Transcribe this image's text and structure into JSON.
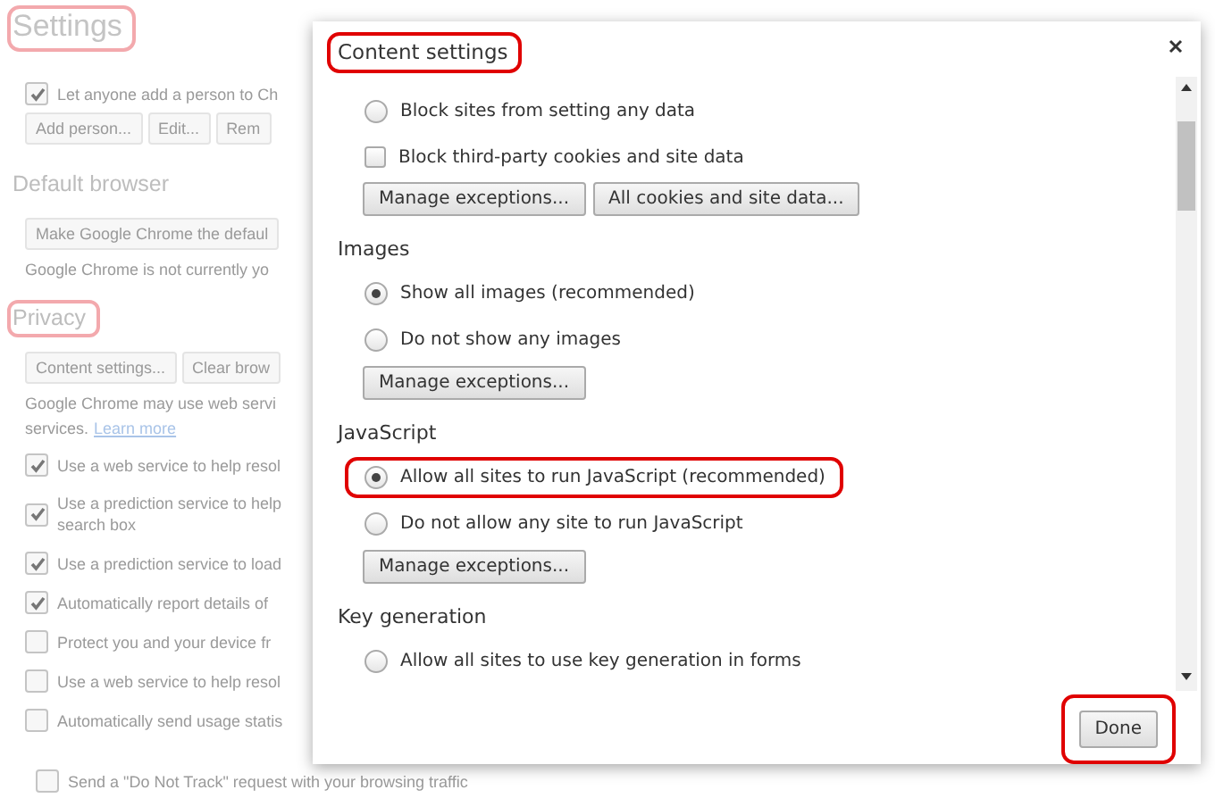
{
  "background": {
    "rows": [
      {
        "kind": "title",
        "text": "Settings",
        "highlighted": true
      },
      {
        "kind": "checkbox",
        "label": "Let anyone add a person to Ch",
        "checked": true
      },
      {
        "kind": "buttons",
        "buttons": [
          "Add person...",
          "Edit...",
          "Rem"
        ]
      },
      {
        "kind": "heading",
        "text": "Default browser",
        "highlighted": false
      },
      {
        "kind": "buttons",
        "buttons": [
          "Make Google Chrome the defaul"
        ]
      },
      {
        "kind": "text",
        "text": "Google Chrome is not currently yo"
      },
      {
        "kind": "heading",
        "text": "Privacy",
        "highlighted": true
      },
      {
        "kind": "buttons",
        "buttons": [
          "Content settings...",
          "Clear brow"
        ]
      },
      {
        "kind": "text",
        "text": "Google Chrome may use web servi"
      },
      {
        "kind": "link-text",
        "text": "services.",
        "link": "Learn more"
      },
      {
        "kind": "checkbox",
        "label": "Use a web service to help resol",
        "checked": true
      },
      {
        "kind": "checkbox",
        "label": "Use a prediction service to help",
        "label_continued": "search box",
        "checked": true
      },
      {
        "kind": "checkbox",
        "label": "Use a prediction service to load",
        "checked": true
      },
      {
        "kind": "checkbox",
        "label": "Automatically report details of",
        "checked": true
      },
      {
        "kind": "checkbox",
        "label": "Protect you and your device fr",
        "checked": false
      },
      {
        "kind": "checkbox",
        "label": "Use a web service to help resol",
        "checked": false
      },
      {
        "kind": "checkbox",
        "label": "Automatically send usage statis",
        "checked": false
      }
    ],
    "last_row": {
      "label": "Send a \"Do Not Track\" request with your browsing traffic",
      "checked": false
    }
  },
  "dialog": {
    "title": {
      "text": "Content settings",
      "highlighted": true
    },
    "sections": [
      {
        "rows": [
          {
            "kind": "radio",
            "label": "Block sites from setting any data",
            "selected": false,
            "highlighted": false
          },
          {
            "kind": "checkbox",
            "label": "Block third-party cookies and site data",
            "checked": false
          },
          {
            "kind": "buttons",
            "buttons": [
              "Manage exceptions...",
              "All cookies and site data..."
            ]
          }
        ]
      },
      {
        "heading": "Images",
        "rows": [
          {
            "kind": "radio",
            "label": "Show all images (recommended)",
            "selected": true,
            "highlighted": false
          },
          {
            "kind": "radio",
            "label": "Do not show any images",
            "selected": false,
            "highlighted": false
          },
          {
            "kind": "buttons",
            "buttons": [
              "Manage exceptions..."
            ]
          }
        ]
      },
      {
        "heading": "JavaScript",
        "rows": [
          {
            "kind": "radio",
            "label": "Allow all sites to run JavaScript (recommended)",
            "selected": true,
            "highlighted": true
          },
          {
            "kind": "radio",
            "label": "Do not allow any site to run JavaScript",
            "selected": false,
            "highlighted": false
          },
          {
            "kind": "buttons",
            "buttons": [
              "Manage exceptions..."
            ]
          }
        ]
      },
      {
        "heading": "Key generation",
        "rows": [
          {
            "kind": "radio",
            "label": "Allow all sites to use key generation in forms",
            "selected": false,
            "highlighted": false
          }
        ]
      }
    ],
    "done": {
      "label": "Done",
      "highlighted": true
    }
  }
}
